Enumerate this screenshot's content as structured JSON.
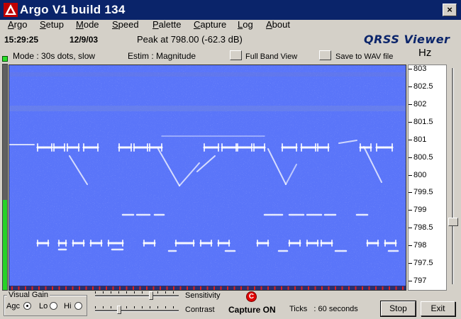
{
  "window": {
    "title": "Argo V1 build 134",
    "close_label": "×"
  },
  "menu": [
    "Argo",
    "Setup",
    "Mode",
    "Speed",
    "Palette",
    "Capture",
    "Log",
    "About"
  ],
  "info": {
    "time": "15:29:25",
    "date": "12/9/03",
    "peak": "Peak at 798.00 (-62.3 dB)",
    "viewer_title": "QRSS Viewer",
    "mode": "Mode : 30s dots, slow",
    "estim": "Estim : Magnitude",
    "full_band_label": "Full Band View",
    "save_wav_label": "Save to WAV file",
    "units": "Hz"
  },
  "scale": {
    "labels": [
      "803",
      "802.5",
      "802",
      "801.5",
      "801",
      "800.5",
      "800",
      "799.5",
      "799",
      "798.5",
      "798",
      "797.5",
      "797"
    ],
    "max": 803.1,
    "min": 796.7
  },
  "signal_level": 0.4,
  "controls": {
    "visual_gain_label": "Visual Gain",
    "agc_label": "Agc",
    "lo_label": "Lo",
    "hi_label": "Hi",
    "gain_selected": "Agc",
    "sensitivity_label": "Sensitivity",
    "contrast_label": "Contrast",
    "sensitivity_value": 0.68,
    "contrast_value": 0.28,
    "capture_led": "C",
    "capture_status": "Capture ON",
    "ticks": "Ticks   : 60 seconds",
    "stop_label": "Stop",
    "exit_label": "Exit",
    "colors": {
      "titlebar": "#0a246a",
      "spectro_bg": "#2a3590",
      "trace": "#ffffff",
      "capture_led": "#e00000",
      "level_ok": "#27d227"
    }
  }
}
